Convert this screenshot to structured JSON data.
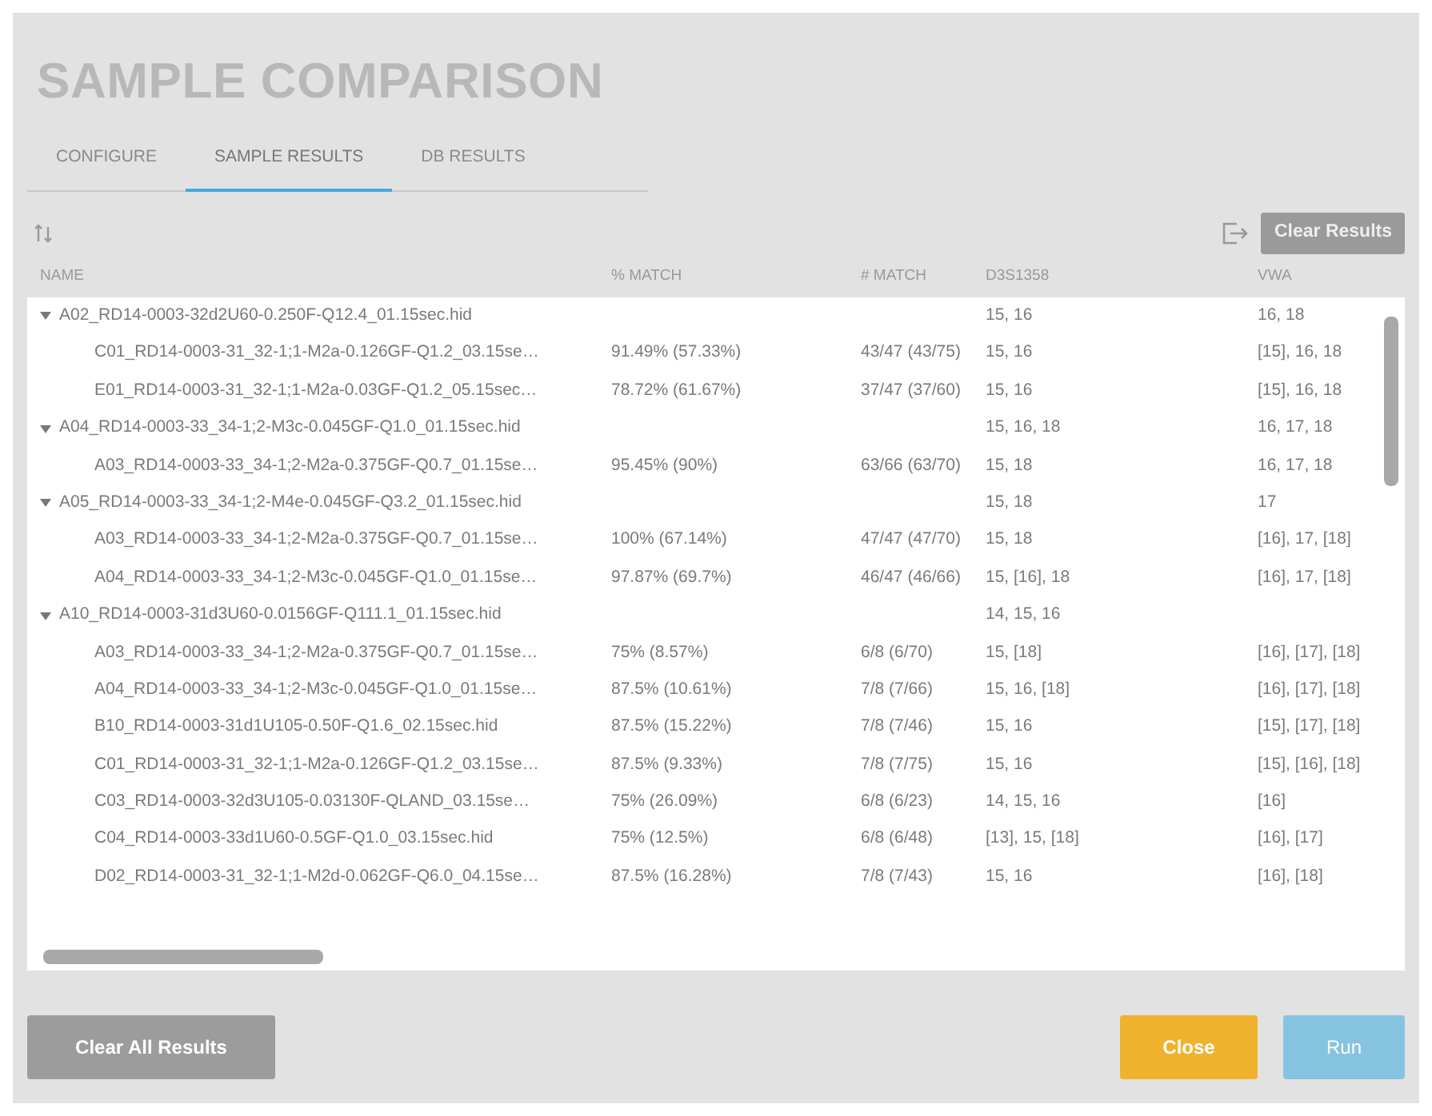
{
  "title": "SAMPLE COMPARISON",
  "tabs": [
    {
      "label": "CONFIGURE",
      "selected": false
    },
    {
      "label": "SAMPLE RESULTS",
      "selected": true
    },
    {
      "label": "DB RESULTS",
      "selected": false
    }
  ],
  "toolbar": {
    "clear_button": "Clear Results"
  },
  "table": {
    "columns": [
      "NAME",
      "% MATCH",
      "# MATCH",
      "D3S1358",
      "VWA"
    ],
    "groups": [
      {
        "name": "A02_RD14-0003-32d2U60-0.250F-Q12.4_01.15sec.hid",
        "d3s1358": "15, 16",
        "vwa": "16, 18",
        "expanded": true,
        "children": [
          {
            "name": "C01_RD14-0003-31_32-1;1-M2a-0.126GF-Q1.2_03.15se…",
            "pct_match": "91.49% (57.33%)",
            "num_match": "43/47 (43/75)",
            "d3s1358": "15, 16",
            "vwa": "[15], 16, 18"
          },
          {
            "name": "E01_RD14-0003-31_32-1;1-M2a-0.03GF-Q1.2_05.15sec…",
            "pct_match": "78.72% (61.67%)",
            "num_match": "37/47 (37/60)",
            "d3s1358": "15, 16",
            "vwa": "[15], 16, 18"
          }
        ]
      },
      {
        "name": "A04_RD14-0003-33_34-1;2-M3c-0.045GF-Q1.0_01.15sec.hid",
        "d3s1358": "15, 16, 18",
        "vwa": "16, 17, 18",
        "expanded": true,
        "children": [
          {
            "name": "A03_RD14-0003-33_34-1;2-M2a-0.375GF-Q0.7_01.15se…",
            "pct_match": "95.45% (90%)",
            "num_match": "63/66 (63/70)",
            "d3s1358": "15, 18",
            "vwa": "16, 17, 18"
          }
        ]
      },
      {
        "name": "A05_RD14-0003-33_34-1;2-M4e-0.045GF-Q3.2_01.15sec.hid",
        "d3s1358": "15, 18",
        "vwa": "17",
        "expanded": true,
        "children": [
          {
            "name": "A03_RD14-0003-33_34-1;2-M2a-0.375GF-Q0.7_01.15se…",
            "pct_match": "100% (67.14%)",
            "num_match": "47/47 (47/70)",
            "d3s1358": "15, 18",
            "vwa": "[16], 17, [18]"
          },
          {
            "name": "A04_RD14-0003-33_34-1;2-M3c-0.045GF-Q1.0_01.15se…",
            "pct_match": "97.87% (69.7%)",
            "num_match": "46/47 (46/66)",
            "d3s1358": "15, [16], 18",
            "vwa": "[16], 17, [18]"
          }
        ]
      },
      {
        "name": "A10_RD14-0003-31d3U60-0.0156GF-Q111.1_01.15sec.hid",
        "d3s1358": "14, 15, 16",
        "expanded": true,
        "children": [
          {
            "name": "A03_RD14-0003-33_34-1;2-M2a-0.375GF-Q0.7_01.15se…",
            "pct_match": "75% (8.57%)",
            "num_match": "6/8 (6/70)",
            "d3s1358": "15, [18]",
            "vwa": "[16], [17], [18]"
          },
          {
            "name": "A04_RD14-0003-33_34-1;2-M3c-0.045GF-Q1.0_01.15se…",
            "pct_match": "87.5% (10.61%)",
            "num_match": "7/8 (7/66)",
            "d3s1358": "15, 16, [18]",
            "vwa": "[16], [17], [18]"
          },
          {
            "name": "B10_RD14-0003-31d1U105-0.50F-Q1.6_02.15sec.hid",
            "pct_match": "87.5% (15.22%)",
            "num_match": "7/8 (7/46)",
            "d3s1358": "15, 16",
            "vwa": "[15], [17], [18]"
          },
          {
            "name": "C01_RD14-0003-31_32-1;1-M2a-0.126GF-Q1.2_03.15se…",
            "pct_match": "87.5% (9.33%)",
            "num_match": "7/8 (7/75)",
            "d3s1358": "15, 16",
            "vwa": "[15], [16], [18]"
          },
          {
            "name": "C03_RD14-0003-32d3U105-0.03130F-QLAND_03.15se…",
            "pct_match": "75% (26.09%)",
            "num_match": "6/8 (6/23)",
            "d3s1358": "14, 15, 16",
            "vwa": "[16]"
          },
          {
            "name": "C04_RD14-0003-33d1U60-0.5GF-Q1.0_03.15sec.hid",
            "pct_match": "75% (12.5%)",
            "num_match": "6/8 (6/48)",
            "d3s1358": "[13], 15, [18]",
            "vwa": "[16], [17]"
          },
          {
            "name": "D02_RD14-0003-31_32-1;1-M2d-0.062GF-Q6.0_04.15se…",
            "pct_match": "87.5% (16.28%)",
            "num_match": "7/8 (7/43)",
            "d3s1358": "15, 16",
            "vwa": "[16], [18]"
          }
        ]
      }
    ]
  },
  "footer": {
    "clear_all_button": "Clear All Results",
    "close_button": "Close",
    "run_button": "Run"
  }
}
